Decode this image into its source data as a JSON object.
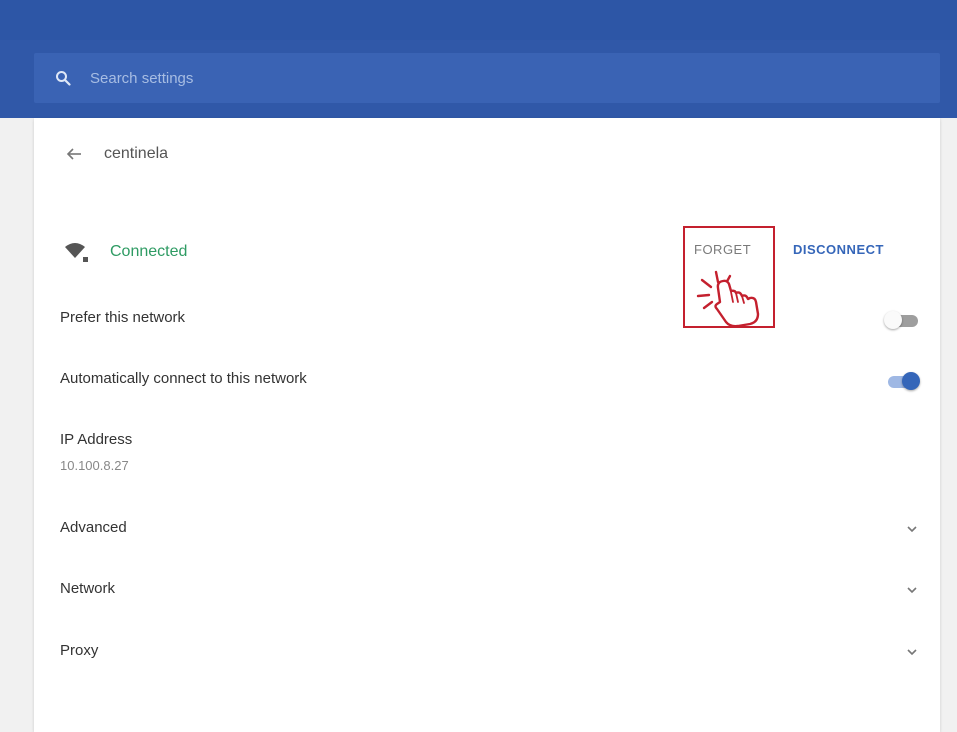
{
  "search": {
    "placeholder": "Search settings",
    "icon": "search-icon"
  },
  "header": {
    "network_name": "centinela",
    "back_icon": "back-arrow-icon"
  },
  "status": {
    "icon": "wifi-icon",
    "text": "Connected",
    "color": "#2e9b63"
  },
  "actions": {
    "forget_label": "FORGET",
    "disconnect_label": "DISCONNECT"
  },
  "settings": {
    "prefer": {
      "label": "Prefer this network",
      "enabled": false
    },
    "auto_connect": {
      "label": "Automatically connect to this network",
      "enabled": true
    }
  },
  "ip": {
    "label": "IP Address",
    "value": "10.100.8.27"
  },
  "sections": [
    {
      "label": "Advanced",
      "icon": "chevron-down-icon"
    },
    {
      "label": "Network",
      "icon": "chevron-down-icon"
    },
    {
      "label": "Proxy",
      "icon": "chevron-down-icon"
    }
  ],
  "colors": {
    "header_blue": "#3058a8",
    "accent_blue": "#3566b9",
    "highlight_red": "#c4202e",
    "connected_green": "#2e9b63"
  }
}
